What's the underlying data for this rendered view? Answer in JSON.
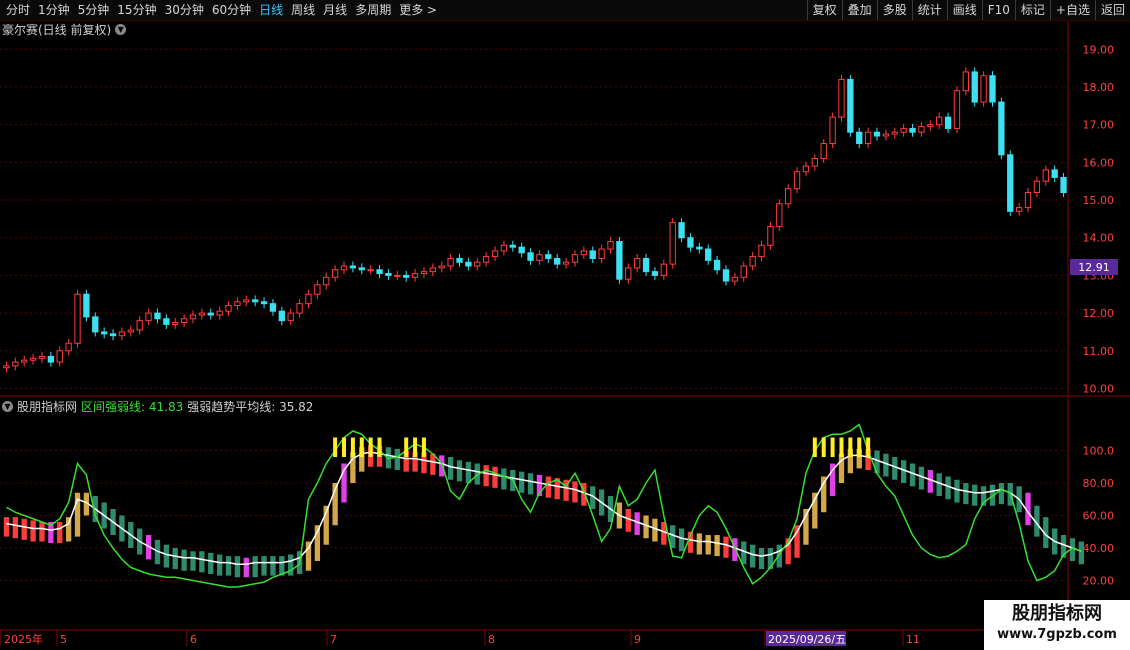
{
  "toolbar": {
    "tabs": [
      {
        "label": "分时",
        "active": false
      },
      {
        "label": "1分钟",
        "active": false
      },
      {
        "label": "5分钟",
        "active": false
      },
      {
        "label": "15分钟",
        "active": false
      },
      {
        "label": "30分钟",
        "active": false
      },
      {
        "label": "60分钟",
        "active": false
      },
      {
        "label": "日线",
        "active": true
      },
      {
        "label": "周线",
        "active": false
      },
      {
        "label": "月线",
        "active": false
      },
      {
        "label": "多周期",
        "active": false
      },
      {
        "label": "更多 >",
        "active": false
      }
    ],
    "tools": [
      "复权",
      "叠加",
      "多股",
      "统计",
      "画线",
      "F10",
      "标记",
      "+自选",
      "返回"
    ]
  },
  "price_panel": {
    "title": "豪尔赛(日线 前复权)",
    "current_price_tag": "12.91",
    "y_ticks": [
      "19.00",
      "18.00",
      "17.00",
      "16.00",
      "15.00",
      "14.00",
      "13.00",
      "12.00",
      "11.00",
      "10.00"
    ]
  },
  "indicator_panel": {
    "name": "股朋指标网",
    "line1_label": "区间强弱线: 41.83",
    "line2_label": "强弱趋势平均线: 35.82",
    "y_ticks": [
      "100.0",
      "80.00",
      "60.00",
      "40.00",
      "20.00"
    ]
  },
  "time_axis": {
    "labels": [
      "2025年",
      "5",
      "6",
      "7",
      "8",
      "9",
      "2025/09/26/五",
      "11"
    ]
  },
  "watermark": {
    "title": "股朋指标网",
    "url": "www.7gpzb.com"
  },
  "colors": {
    "up": "#ff3c3c",
    "down": "#3de0f0",
    "grid": "#5a0000",
    "green_line": "#36e030",
    "teal_bar": "#2e8b6e",
    "gold_bar": "#d4a84a",
    "magenta_bar": "#e040e8",
    "yellow_mark": "#ffee22",
    "price_tag_bg": "#5a2a9a"
  },
  "chart_data": {
    "type": "candlestick",
    "price_ylim": [
      9.8,
      19.3
    ],
    "indicator_ylim": [
      8,
      120
    ],
    "closes": [
      10.6,
      10.7,
      10.75,
      10.8,
      10.85,
      10.7,
      11.0,
      11.2,
      12.5,
      11.9,
      11.5,
      11.45,
      11.4,
      11.5,
      11.55,
      11.8,
      12.0,
      11.85,
      11.7,
      11.75,
      11.85,
      11.95,
      12.0,
      11.95,
      12.05,
      12.2,
      12.3,
      12.35,
      12.3,
      12.25,
      12.05,
      11.8,
      12.0,
      12.25,
      12.5,
      12.75,
      12.95,
      13.15,
      13.25,
      13.2,
      13.15,
      13.15,
      13.05,
      13.0,
      13.0,
      12.95,
      13.05,
      13.1,
      13.2,
      13.25,
      13.45,
      13.35,
      13.25,
      13.35,
      13.5,
      13.65,
      13.8,
      13.75,
      13.6,
      13.4,
      13.55,
      13.45,
      13.3,
      13.35,
      13.55,
      13.65,
      13.45,
      13.7,
      13.9,
      12.9,
      13.2,
      13.45,
      13.1,
      13.0,
      13.3,
      14.4,
      14.0,
      13.75,
      13.7,
      13.4,
      13.15,
      12.85,
      12.95,
      13.25,
      13.5,
      13.8,
      14.3,
      14.9,
      15.3,
      15.75,
      15.9,
      16.1,
      16.5,
      17.2,
      18.2,
      16.8,
      16.5,
      16.8,
      16.7,
      16.75,
      16.8,
      16.9,
      16.8,
      16.95,
      17.0,
      17.2,
      16.9,
      17.9,
      18.4,
      17.6,
      18.3,
      17.6,
      16.2,
      14.7,
      14.8,
      15.2,
      15.5,
      15.8,
      15.6,
      15.2
    ],
    "line1": [
      65,
      62,
      60,
      58,
      56,
      54,
      58,
      68,
      92,
      85,
      60,
      48,
      40,
      33,
      28,
      26,
      24,
      23,
      22,
      22,
      21,
      20,
      19,
      18,
      17,
      16,
      16,
      17,
      18,
      19,
      22,
      24,
      26,
      30,
      70,
      80,
      92,
      100,
      108,
      112,
      110,
      104,
      100,
      95,
      96,
      100,
      104,
      102,
      98,
      92,
      75,
      70,
      80,
      85,
      88,
      86,
      84,
      82,
      70,
      62,
      74,
      80,
      82,
      78,
      86,
      75,
      60,
      44,
      52,
      78,
      66,
      70,
      80,
      88,
      60,
      35,
      34,
      48,
      60,
      66,
      62,
      52,
      40,
      28,
      18,
      22,
      28,
      36,
      44,
      58,
      86,
      100,
      108,
      110,
      110,
      112,
      116,
      100,
      86,
      78,
      72,
      60,
      48,
      40,
      36,
      34,
      35,
      38,
      42,
      58,
      68,
      72,
      76,
      74,
      55,
      32,
      20,
      22,
      26,
      36,
      40,
      38
    ],
    "line2": [
      55,
      54,
      53,
      52,
      52,
      51,
      52,
      55,
      70,
      68,
      64,
      60,
      56,
      52,
      48,
      44,
      41,
      38,
      36,
      35,
      34,
      34,
      33,
      32,
      31,
      31,
      30,
      30,
      31,
      31,
      31,
      31,
      32,
      34,
      40,
      50,
      62,
      76,
      88,
      95,
      98,
      99,
      98,
      97,
      96,
      95,
      95,
      94,
      93,
      92,
      90,
      89,
      88,
      87,
      86,
      85,
      84,
      83,
      82,
      81,
      80,
      79,
      78,
      77,
      76,
      74,
      72,
      68,
      64,
      60,
      58,
      56,
      54,
      52,
      50,
      48,
      46,
      45,
      44,
      44,
      43,
      42,
      40,
      38,
      36,
      35,
      36,
      38,
      42,
      50,
      60,
      70,
      80,
      88,
      94,
      97,
      97,
      96,
      94,
      92,
      90,
      88,
      86,
      84,
      82,
      80,
      78,
      76,
      75,
      74,
      74,
      75,
      76,
      74,
      70,
      62,
      55,
      48,
      44,
      42,
      40,
      38
    ]
  }
}
